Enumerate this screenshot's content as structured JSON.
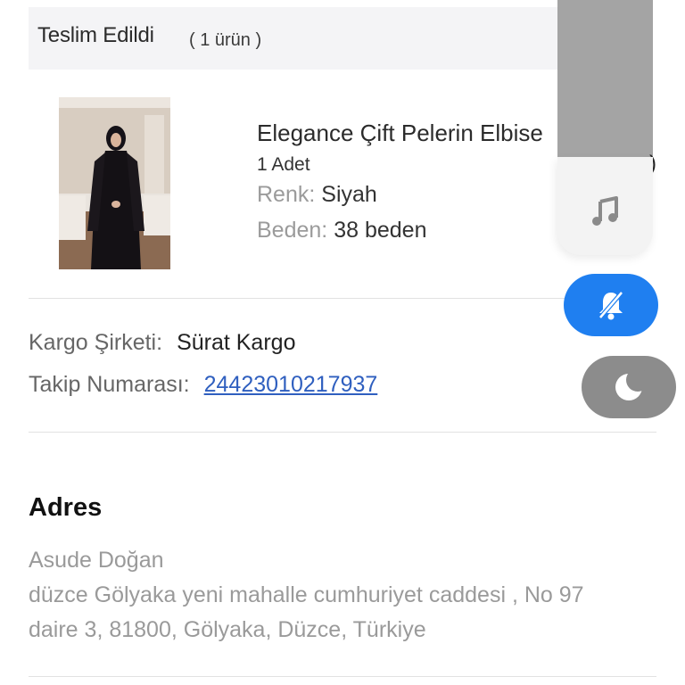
{
  "order_status": {
    "title": "Teslim Edildi",
    "item_count": "( 1 ürün )"
  },
  "product": {
    "name": "Elegance Çift Pelerin Elbise",
    "quantity": "1 Adet",
    "color_label": "Renk:",
    "color_value": "Siyah",
    "size_label": "Beden:",
    "size_value": "38 beden"
  },
  "shipping": {
    "carrier_label": "Kargo Şirketi:",
    "carrier_value": "Sürat Kargo",
    "tracking_label": "Takip Numarası:",
    "tracking_number": "24423010217937"
  },
  "address": {
    "title": "Adres",
    "name": "Asude Doğan",
    "line1": "düzce Gölyaka yeni mahalle cumhuriyet caddesi , No 97",
    "line2": "daire 3, 81800, Gölyaka, Düzce, Türkiye"
  },
  "overlay": {
    "partial_text": ")",
    "icons": [
      "music-note-icon",
      "silent-bell-slash-icon",
      "moon-icon"
    ],
    "colors": {
      "silent_toggle": "#1f7ff0",
      "dnd_toggle": "#8c8c8c",
      "panel": "#a4a4a4"
    }
  }
}
